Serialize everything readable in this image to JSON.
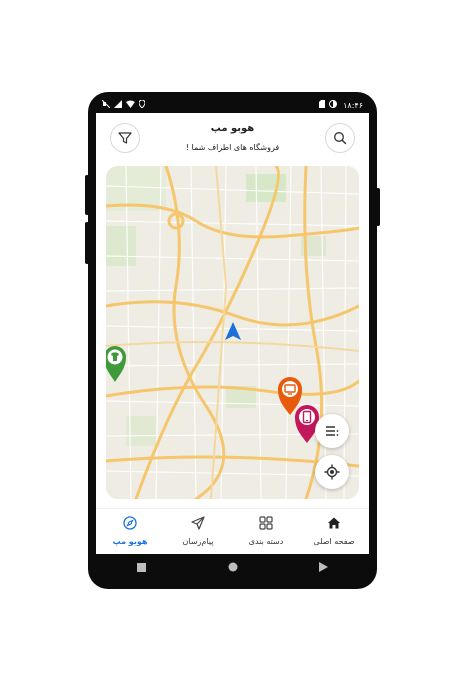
{
  "status_bar": {
    "time": "۱۸:۴۶",
    "icons_left": [
      "mute-icon",
      "signal-icon",
      "wifi-icon",
      "location-icon"
    ],
    "icons_right": [
      "sim-icon",
      "battery-icon"
    ]
  },
  "header": {
    "title": "هوبو مپ",
    "subtitle": "فروشگاه های اطراف شما !",
    "filter_icon": "filter-icon",
    "search_icon": "search-icon"
  },
  "map": {
    "pins": [
      {
        "name": "clothing-store-pin",
        "icon": "shirt-icon",
        "color": "#3e9a3a"
      },
      {
        "name": "electronics-store-pin",
        "icon": "monitor-icon",
        "color": "#e85a0c"
      },
      {
        "name": "mobile-store-pin",
        "icon": "mobile-phone-icon",
        "color": "#c2185b"
      }
    ],
    "user_marker_color": "#1e6fd9",
    "list_button_icon": "list-icon",
    "locate_button_icon": "my-location-icon"
  },
  "bottom_nav": {
    "items": [
      {
        "label": "صفحه اصلی",
        "icon": "home-icon",
        "active": false
      },
      {
        "label": "دسته بندی",
        "icon": "grid-icon",
        "active": false
      },
      {
        "label": "پیام‌رسان",
        "icon": "send-icon",
        "active": false
      },
      {
        "label": "هوبو مپ",
        "icon": "compass-icon",
        "active": true
      }
    ]
  },
  "system_nav": [
    "stop-icon",
    "home-circle-icon",
    "back-triangle-icon"
  ],
  "colors": {
    "accent": "#1a73e8",
    "map_bg": "#efece4",
    "major_road": "#f5c66b",
    "minor_road": "#ffffff"
  }
}
